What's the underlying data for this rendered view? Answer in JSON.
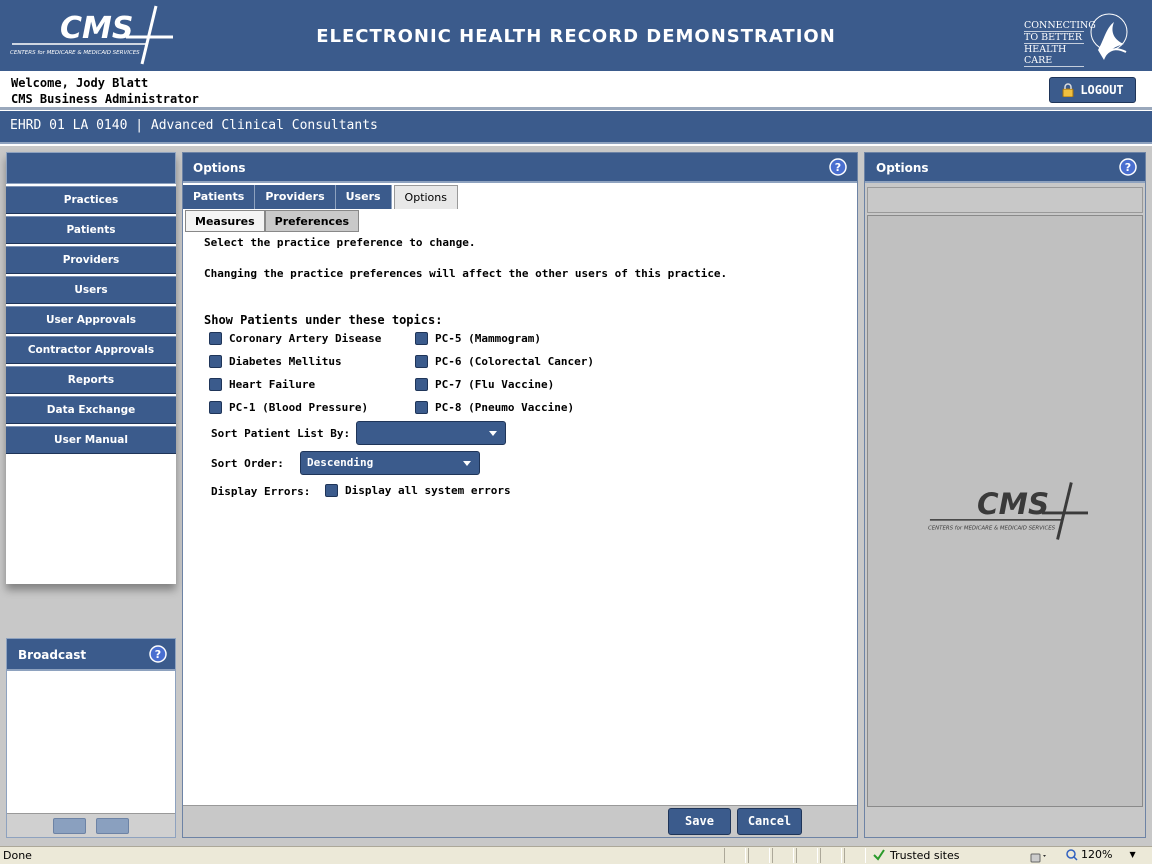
{
  "header": {
    "title": "ELECTRONIC HEALTH RECORD DEMONSTRATION",
    "logo_text": "CMS",
    "logo_subtext": "CENTERS for MEDICARE & MEDICAID SERVICES",
    "hhs_lines": [
      "CONNECTING",
      "TO BETTER",
      "HEALTH CARE"
    ]
  },
  "welcome": {
    "line1": "Welcome, Jody Blatt",
    "line2": "CMS Business Administrator",
    "logout_label": "LOGOUT"
  },
  "practice_bar": {
    "text": "EHRD 01 LA 0140 | Advanced Clinical Consultants"
  },
  "nav": {
    "items": [
      "Practices",
      "Patients",
      "Providers",
      "Users",
      "User Approvals",
      "Contractor Approvals",
      "Reports",
      "Data Exchange",
      "User Manual"
    ]
  },
  "broadcast": {
    "title": "Broadcast"
  },
  "main": {
    "title": "Options",
    "tabs": [
      "Patients",
      "Providers",
      "Users",
      "Options"
    ],
    "active_tab": "Options",
    "subtabs": [
      "Measures",
      "Preferences"
    ],
    "active_subtab": "Preferences",
    "intro1": "Select the practice preference to change.",
    "intro2": "Changing the practice preferences will affect the other users of this practice.",
    "topics_heading": "Show Patients under these topics:",
    "topics_left": [
      "Coronary Artery Disease",
      "Diabetes Mellitus",
      "Heart Failure",
      "PC-1 (Blood Pressure)"
    ],
    "topics_right": [
      "PC-5 (Mammogram)",
      "PC-6 (Colorectal Cancer)",
      "PC-7 (Flu Vaccine)",
      "PC-8 (Pneumo Vaccine)"
    ],
    "sort_by_label": "Sort Patient List By:",
    "sort_by_value": "",
    "sort_order_label": "Sort Order:",
    "sort_order_value": "Descending",
    "display_errors_label": "Display Errors:",
    "display_errors_option": "Display all system errors",
    "save_label": "Save",
    "cancel_label": "Cancel"
  },
  "right": {
    "title": "Options",
    "logo_text": "CMS",
    "logo_subtext": "CENTERS for MEDICARE & MEDICAID SERVICES"
  },
  "statusbar": {
    "left": "Done",
    "zone": "Trusted sites",
    "zoom": "120%"
  },
  "colors": {
    "brand_blue": "#3b5b8c",
    "panel_gray": "#c8c8c8"
  }
}
